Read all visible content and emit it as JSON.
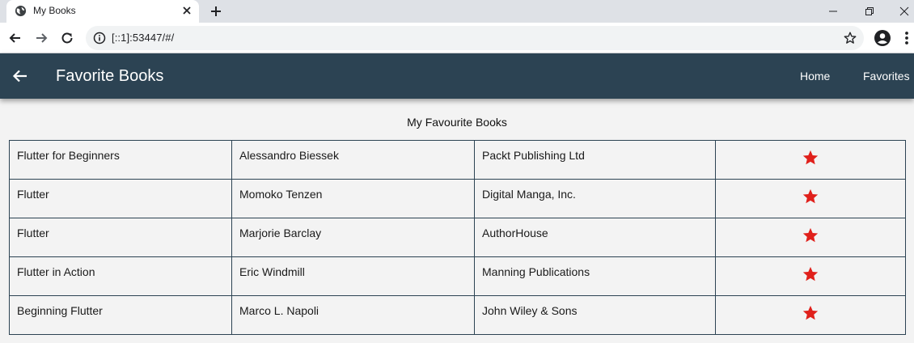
{
  "browser": {
    "tab_title": "My Books",
    "url": "[::1]:53447/#/",
    "icons": {
      "tab": "globe-icon",
      "close": "close-icon",
      "new_tab": "plus-icon",
      "back": "arrow-left-icon",
      "forward": "arrow-right-icon",
      "reload": "reload-icon",
      "site_info": "info-icon",
      "bookmark": "star-outline-icon",
      "profile": "account-icon",
      "menu": "kebab-menu-icon"
    }
  },
  "appbar": {
    "title": "Favorite Books",
    "nav": [
      "Home",
      "Favorites"
    ],
    "background": "#2c4353"
  },
  "page": {
    "caption": "My Favourite Books",
    "favorite_icon": "star-icon",
    "favorite_color": "#e0201b"
  },
  "books": [
    {
      "title": "Flutter for Beginners",
      "author": "Alessandro Biessek",
      "publisher": "Packt Publishing Ltd"
    },
    {
      "title": "Flutter",
      "author": "Momoko Tenzen",
      "publisher": "Digital Manga, Inc."
    },
    {
      "title": "Flutter",
      "author": "Marjorie Barclay",
      "publisher": "AuthorHouse"
    },
    {
      "title": "Flutter in Action",
      "author": "Eric Windmill",
      "publisher": "Manning Publications"
    },
    {
      "title": "Beginning Flutter",
      "author": "Marco L. Napoli",
      "publisher": "John Wiley & Sons"
    }
  ]
}
